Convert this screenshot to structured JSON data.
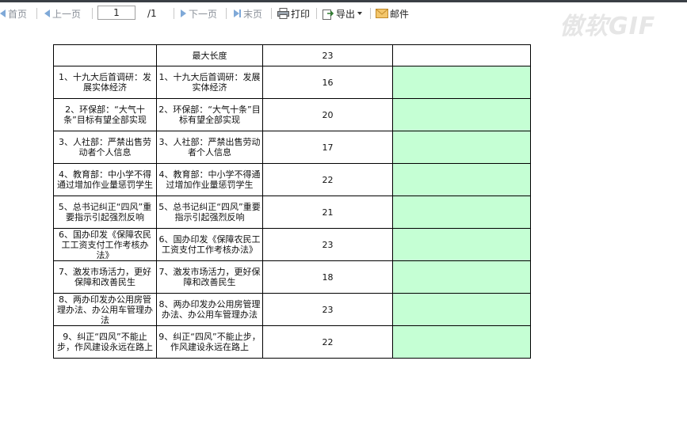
{
  "toolbar": {
    "first": "首页",
    "prev": "上一页",
    "page_value": "1",
    "page_total": "/1",
    "next": "下一页",
    "last": "末页",
    "print": "打印",
    "export": "导出",
    "mail": "邮件"
  },
  "watermark": "傲软GIF",
  "header_row": {
    "label": "最大长度",
    "value": "23"
  },
  "rows": [
    {
      "a": "1、十九大后首调研：发展实体经济",
      "b": "1、十九大后首调研：发展实体经济",
      "n": "16"
    },
    {
      "a": "2、环保部：“大气十条”目标有望全部实现",
      "b": "2、环保部：“大气十条”目标有望全部实现",
      "n": "20"
    },
    {
      "a": "3、人社部：严禁出售劳动者个人信息",
      "b": "3、人社部：严禁出售劳动者个人信息",
      "n": "17"
    },
    {
      "a": "4、教育部：中小学不得通过增加作业量惩罚学生",
      "b": "4、教育部：中小学不得通过增加作业量惩罚学生",
      "n": "22"
    },
    {
      "a": "5、总书记纠正“四风”重要指示引起强烈反响",
      "b": "5、总书记纠正“四风”重要指示引起强烈反响",
      "n": "21"
    },
    {
      "a": "6、国办印发《保障农民工工资支付工作考核办法》",
      "b": "6、国办印发《保障农民工工资支付工作考核办法》",
      "n": "23"
    },
    {
      "a": "7、激发市场活力，更好保障和改善民生",
      "b": "7、激发市场活力，更好保障和改善民生",
      "n": "18"
    },
    {
      "a": "8、两办印发办公用房管理办法、办公用车管理办法",
      "b": "8、两办印发办公用房管理办法、办公用车管理办法",
      "n": "23"
    },
    {
      "a": "9、纠正“四风”不能止步，作风建设永远在路上",
      "b": "9、纠正“四风”不能止步，作风建设永远在路上",
      "n": "22"
    }
  ],
  "colors": {
    "highlight_cell": "#c5ffd4",
    "toolbar_icon": "#7fa9d8"
  },
  "icons": [
    "first-page-icon",
    "prev-page-icon",
    "next-page-icon",
    "last-page-icon",
    "print-icon",
    "export-icon",
    "chevron-down-icon",
    "mail-icon"
  ]
}
